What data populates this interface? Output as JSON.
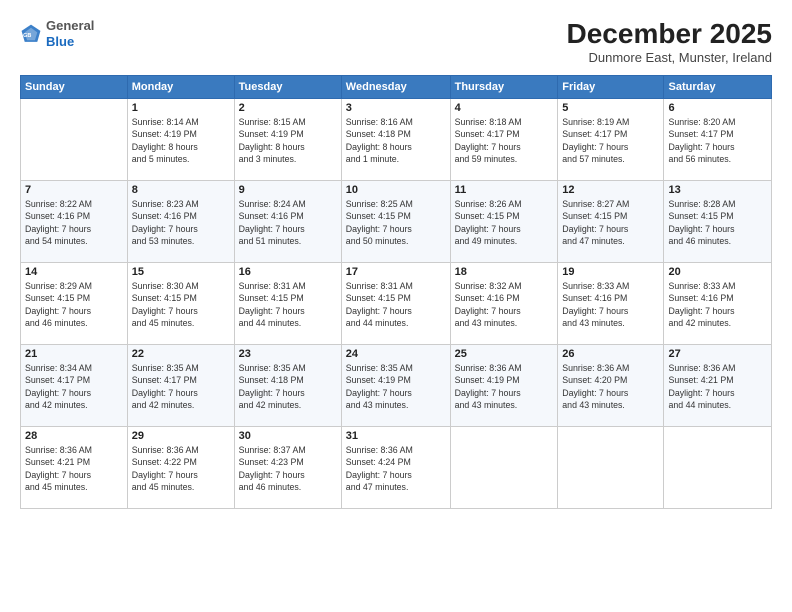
{
  "header": {
    "logo": {
      "line1": "General",
      "line2": "Blue"
    },
    "title": "December 2025",
    "subtitle": "Dunmore East, Munster, Ireland"
  },
  "days_of_week": [
    "Sunday",
    "Monday",
    "Tuesday",
    "Wednesday",
    "Thursday",
    "Friday",
    "Saturday"
  ],
  "weeks": [
    [
      {
        "day": "",
        "content": ""
      },
      {
        "day": "1",
        "content": "Sunrise: 8:14 AM\nSunset: 4:19 PM\nDaylight: 8 hours\nand 5 minutes."
      },
      {
        "day": "2",
        "content": "Sunrise: 8:15 AM\nSunset: 4:19 PM\nDaylight: 8 hours\nand 3 minutes."
      },
      {
        "day": "3",
        "content": "Sunrise: 8:16 AM\nSunset: 4:18 PM\nDaylight: 8 hours\nand 1 minute."
      },
      {
        "day": "4",
        "content": "Sunrise: 8:18 AM\nSunset: 4:17 PM\nDaylight: 7 hours\nand 59 minutes."
      },
      {
        "day": "5",
        "content": "Sunrise: 8:19 AM\nSunset: 4:17 PM\nDaylight: 7 hours\nand 57 minutes."
      },
      {
        "day": "6",
        "content": "Sunrise: 8:20 AM\nSunset: 4:17 PM\nDaylight: 7 hours\nand 56 minutes."
      }
    ],
    [
      {
        "day": "7",
        "content": "Sunrise: 8:22 AM\nSunset: 4:16 PM\nDaylight: 7 hours\nand 54 minutes."
      },
      {
        "day": "8",
        "content": "Sunrise: 8:23 AM\nSunset: 4:16 PM\nDaylight: 7 hours\nand 53 minutes."
      },
      {
        "day": "9",
        "content": "Sunrise: 8:24 AM\nSunset: 4:16 PM\nDaylight: 7 hours\nand 51 minutes."
      },
      {
        "day": "10",
        "content": "Sunrise: 8:25 AM\nSunset: 4:15 PM\nDaylight: 7 hours\nand 50 minutes."
      },
      {
        "day": "11",
        "content": "Sunrise: 8:26 AM\nSunset: 4:15 PM\nDaylight: 7 hours\nand 49 minutes."
      },
      {
        "day": "12",
        "content": "Sunrise: 8:27 AM\nSunset: 4:15 PM\nDaylight: 7 hours\nand 47 minutes."
      },
      {
        "day": "13",
        "content": "Sunrise: 8:28 AM\nSunset: 4:15 PM\nDaylight: 7 hours\nand 46 minutes."
      }
    ],
    [
      {
        "day": "14",
        "content": "Sunrise: 8:29 AM\nSunset: 4:15 PM\nDaylight: 7 hours\nand 46 minutes."
      },
      {
        "day": "15",
        "content": "Sunrise: 8:30 AM\nSunset: 4:15 PM\nDaylight: 7 hours\nand 45 minutes."
      },
      {
        "day": "16",
        "content": "Sunrise: 8:31 AM\nSunset: 4:15 PM\nDaylight: 7 hours\nand 44 minutes."
      },
      {
        "day": "17",
        "content": "Sunrise: 8:31 AM\nSunset: 4:15 PM\nDaylight: 7 hours\nand 44 minutes."
      },
      {
        "day": "18",
        "content": "Sunrise: 8:32 AM\nSunset: 4:16 PM\nDaylight: 7 hours\nand 43 minutes."
      },
      {
        "day": "19",
        "content": "Sunrise: 8:33 AM\nSunset: 4:16 PM\nDaylight: 7 hours\nand 43 minutes."
      },
      {
        "day": "20",
        "content": "Sunrise: 8:33 AM\nSunset: 4:16 PM\nDaylight: 7 hours\nand 42 minutes."
      }
    ],
    [
      {
        "day": "21",
        "content": "Sunrise: 8:34 AM\nSunset: 4:17 PM\nDaylight: 7 hours\nand 42 minutes."
      },
      {
        "day": "22",
        "content": "Sunrise: 8:35 AM\nSunset: 4:17 PM\nDaylight: 7 hours\nand 42 minutes."
      },
      {
        "day": "23",
        "content": "Sunrise: 8:35 AM\nSunset: 4:18 PM\nDaylight: 7 hours\nand 42 minutes."
      },
      {
        "day": "24",
        "content": "Sunrise: 8:35 AM\nSunset: 4:19 PM\nDaylight: 7 hours\nand 43 minutes."
      },
      {
        "day": "25",
        "content": "Sunrise: 8:36 AM\nSunset: 4:19 PM\nDaylight: 7 hours\nand 43 minutes."
      },
      {
        "day": "26",
        "content": "Sunrise: 8:36 AM\nSunset: 4:20 PM\nDaylight: 7 hours\nand 43 minutes."
      },
      {
        "day": "27",
        "content": "Sunrise: 8:36 AM\nSunset: 4:21 PM\nDaylight: 7 hours\nand 44 minutes."
      }
    ],
    [
      {
        "day": "28",
        "content": "Sunrise: 8:36 AM\nSunset: 4:21 PM\nDaylight: 7 hours\nand 45 minutes."
      },
      {
        "day": "29",
        "content": "Sunrise: 8:36 AM\nSunset: 4:22 PM\nDaylight: 7 hours\nand 45 minutes."
      },
      {
        "day": "30",
        "content": "Sunrise: 8:37 AM\nSunset: 4:23 PM\nDaylight: 7 hours\nand 46 minutes."
      },
      {
        "day": "31",
        "content": "Sunrise: 8:36 AM\nSunset: 4:24 PM\nDaylight: 7 hours\nand 47 minutes."
      },
      {
        "day": "",
        "content": ""
      },
      {
        "day": "",
        "content": ""
      },
      {
        "day": "",
        "content": ""
      }
    ]
  ]
}
